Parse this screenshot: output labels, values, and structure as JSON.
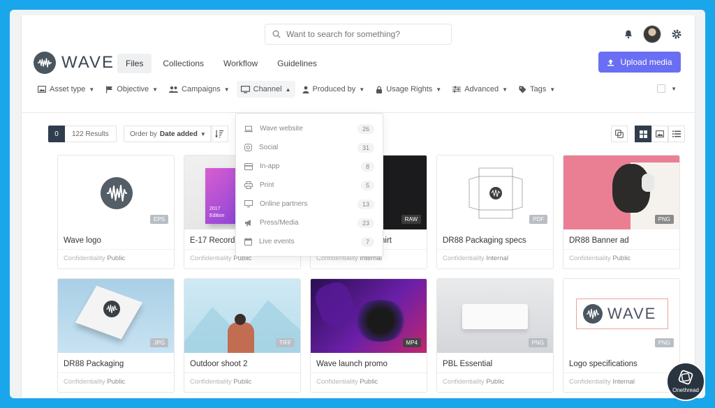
{
  "header": {
    "search_placeholder": "Want to search for something?",
    "logo_text": "WAVE",
    "nav": [
      "Files",
      "Collections",
      "Workflow",
      "Guidelines"
    ],
    "upload_label": "Upload media"
  },
  "filters": [
    "Asset type",
    "Objective",
    "Campaigns",
    "Channel",
    "Produced by",
    "Usage Rights",
    "Advanced",
    "Tags"
  ],
  "toolbar": {
    "selected_count": "0",
    "results": "122 Results",
    "order_prefix": "Order by",
    "order_value": "Date added"
  },
  "channel_dropdown": [
    {
      "label": "Wave website",
      "count": "26"
    },
    {
      "label": "Social",
      "count": "31"
    },
    {
      "label": "In-app",
      "count": "8"
    },
    {
      "label": "Print",
      "count": "5"
    },
    {
      "label": "Online partners",
      "count": "13"
    },
    {
      "label": "Press/Media",
      "count": "23"
    },
    {
      "label": "Live events",
      "count": "7"
    }
  ],
  "cards": [
    {
      "title": "Wave logo",
      "format": "EPS",
      "label": "Confidentiality",
      "conf": "Public"
    },
    {
      "title": "E-17 Record",
      "format": "",
      "label": "Confidentiality",
      "conf": "Public"
    },
    {
      "title": "hirt",
      "format": "RAW",
      "label": "Confidentiality",
      "conf": "Internal"
    },
    {
      "title": "DR88 Packaging specs",
      "format": "PDF",
      "label": "Confidentiality",
      "conf": "Internal"
    },
    {
      "title": "DR88 Banner ad",
      "format": "PNG",
      "label": "Confidentiality",
      "conf": "Public"
    },
    {
      "title": "DR88 Packaging",
      "format": "JPG",
      "label": "Confidentiality",
      "conf": "Public"
    },
    {
      "title": "Outdoor shoot 2",
      "format": "TIFF",
      "label": "Confidentiality",
      "conf": "Public"
    },
    {
      "title": "Wave launch promo",
      "format": "MP4",
      "label": "Confidentiality",
      "conf": "Public"
    },
    {
      "title": "PBL Essential",
      "format": "PNG",
      "label": "Confidentiality",
      "conf": "Public"
    },
    {
      "title": "Logo specifications",
      "format": "PNG",
      "label": "Confidentiality",
      "conf": "Internal"
    }
  ],
  "thumb_extras": {
    "record_year": "2017",
    "record_edition": "Edition",
    "logo_spec_text": "WAVE"
  },
  "watermark": "Onethread",
  "colors": {
    "accent": "#6a6ef3",
    "dark": "#2f3d4c",
    "frame": "#1aa6ea"
  }
}
